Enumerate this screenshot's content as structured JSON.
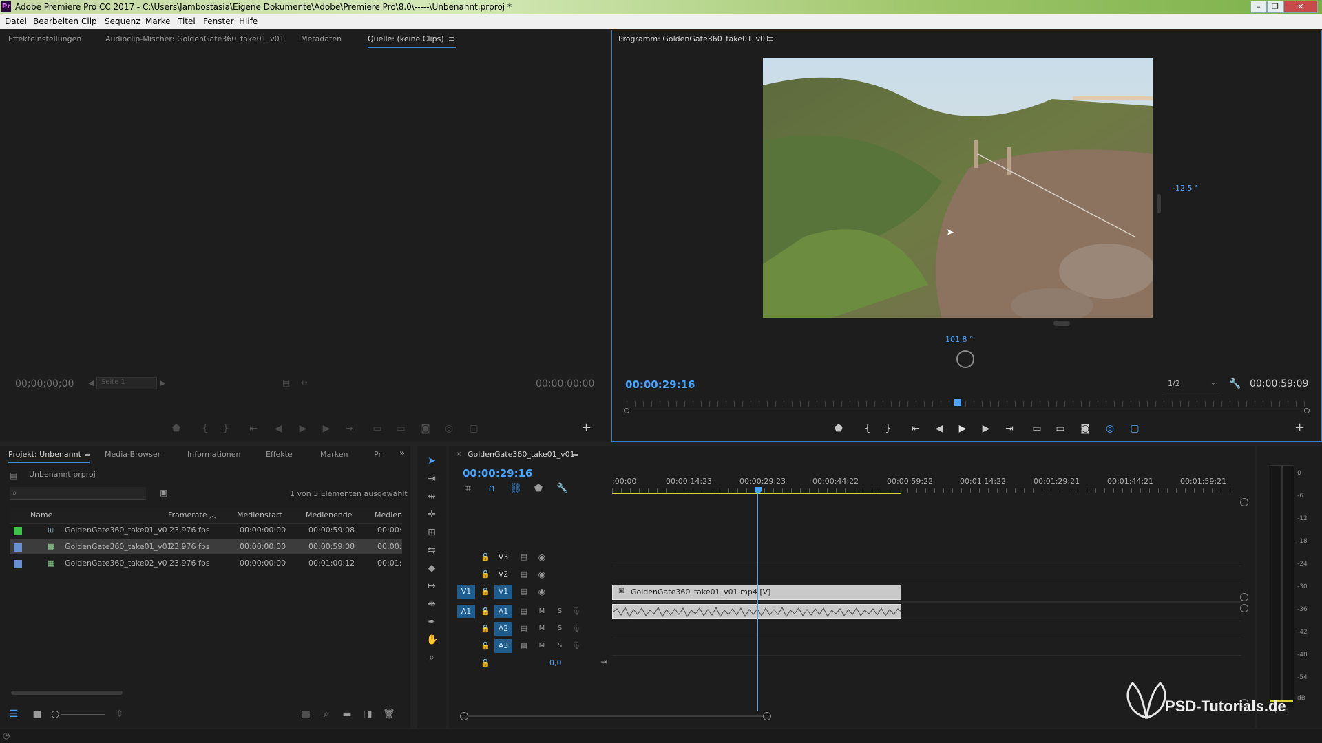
{
  "app": {
    "title": "Adobe Premiere Pro CC 2017 - C:\\Users\\Jambostasia\\Eigene Dokumente\\Adobe\\Premiere Pro\\8.0\\-----\\Unbenannt.prproj *",
    "icon_label": "Pr"
  },
  "menu": [
    "Datei",
    "Bearbeiten",
    "Clip",
    "Sequenz",
    "Marke",
    "Titel",
    "Fenster",
    "Hilfe"
  ],
  "source_panel": {
    "tabs": [
      "Effekteinstellungen",
      "Audioclip-Mischer: GoldenGate360_take01_v01",
      "Metadaten",
      "Quelle: (keine Clips)"
    ],
    "timecode_left": "00;00;00;00",
    "page_select": "Seite 1",
    "timecode_right": "00;00;00;00"
  },
  "program_panel": {
    "tab": "Programm: GoldenGate360_take01_v01",
    "angle_right": "-12,5 °",
    "angle_bottom": "101,8 °",
    "timecode": "00:00:29:16",
    "zoom": "1/2",
    "duration": "00:00:59:09",
    "playhead_fraction": 0.49,
    "video_thumbnail": "golden-gate-hillside-360-video"
  },
  "project_panel": {
    "tabs": [
      "Projekt: Unbenannt",
      "Media-Browser",
      "Informationen",
      "Effekte",
      "Marken",
      "Pr"
    ],
    "project_file": "Unbenannt.prproj",
    "selection_info": "1 von 3 Elementen ausgewählt",
    "columns": [
      "Name",
      "Framerate",
      "Medienstart",
      "Medienende",
      "Medien"
    ],
    "items": [
      {
        "color": "#3ec24a",
        "name": "GoldenGate360_take01_v0",
        "framerate": "23,976 fps",
        "start": "00:00:00:00",
        "end": "00:00:59:08",
        "dur": "00:00:",
        "type": "sequence"
      },
      {
        "color": "#6a8fcf",
        "name": "GoldenGate360_take01_v01",
        "framerate": "23,976 fps",
        "start": "00:00:00:00",
        "end": "00:00:59:08",
        "dur": "00:00:",
        "type": "clip",
        "selected": true
      },
      {
        "color": "#6a8fcf",
        "name": "GoldenGate360_take02_v0",
        "framerate": "23,976 fps",
        "start": "00:00:00:00",
        "end": "00:01:00:12",
        "dur": "00:01:",
        "type": "clip"
      }
    ]
  },
  "timeline": {
    "tab": "GoldenGate360_take01_v01",
    "timecode": "00:00:29:16",
    "ruler_labels": [
      ":00:00",
      "00:00:14:23",
      "00:00:29:23",
      "00:00:44:22",
      "00:00:59:22",
      "00:01:14:22",
      "00:01:29:21",
      "00:01:44:21",
      "00:01:59:21"
    ],
    "video_tracks": [
      "V3",
      "V2",
      "V1"
    ],
    "audio_tracks": [
      "A1",
      "A2",
      "A3"
    ],
    "source_v": "V1",
    "source_a": "A1",
    "master_value": "0,0",
    "video_clip": "GoldenGate360_take01_v01.mp4 [V]",
    "m_label": "M",
    "s_label": "S"
  },
  "meter": {
    "labels": [
      "0",
      "-6",
      "-12",
      "-18",
      "-24",
      "-30",
      "-36",
      "-42",
      "-48",
      "-54",
      "dB"
    ],
    "solo": [
      "S",
      "S"
    ]
  },
  "watermark": "PSD-Tutorials.de"
}
